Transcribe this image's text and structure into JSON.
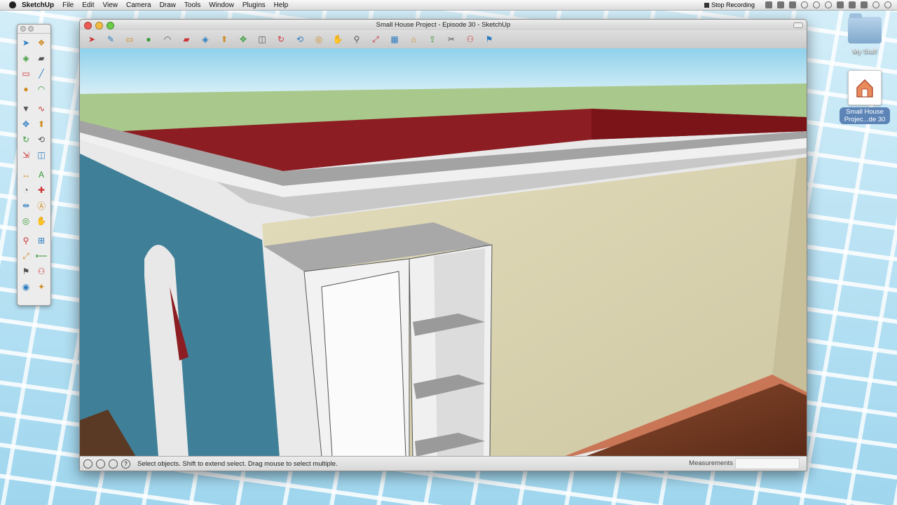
{
  "menubar": {
    "app_name": "SketchUp",
    "items": [
      "File",
      "Edit",
      "View",
      "Camera",
      "Draw",
      "Tools",
      "Window",
      "Plugins",
      "Help"
    ],
    "stop_recording": "Stop Recording"
  },
  "desktop": {
    "icon_folder_label": "My Stuff",
    "icon_file_label": "Small House Projec...de 30"
  },
  "window": {
    "title": "Small House Project - Episode 30 - SketchUp"
  },
  "statusbar": {
    "message": "Select objects. Shift to extend select. Drag mouse to select multiple.",
    "measurements_label": "Measurements",
    "measurements_value": ""
  },
  "colors": {
    "sky": "#8fd1ec",
    "ground": "#a9c98c",
    "wall_blue": "#3f8098",
    "wall_cream": "#d9d3b0",
    "roof_red": "#8c1d22",
    "floor_wood": "#6b3722"
  },
  "toolbar_icons": [
    "select-icon",
    "pencil-icon",
    "rectangle-icon",
    "circle-icon",
    "arc-icon",
    "eraser-icon",
    "paint-bucket-icon",
    "push-pull-icon",
    "move-icon",
    "offset-icon",
    "rotate-icon",
    "follow-me-icon",
    "orbit-icon",
    "pan-icon",
    "zoom-icon",
    "zoom-extents-icon",
    "components-icon",
    "warehouse-icon",
    "share-icon",
    "section-icon",
    "walk-icon",
    "position-camera-icon"
  ],
  "palette_icons": [
    "select-icon",
    "component-icon",
    "paint-bucket-icon",
    "eraser-icon",
    "rectangle-icon",
    "line-icon",
    "circle-icon",
    "arc-icon",
    "polygon-icon",
    "freehand-icon",
    "move-icon",
    "push-pull-icon",
    "rotate-icon",
    "follow-me-icon",
    "scale-icon",
    "offset-icon",
    "tape-measure-icon",
    "text-icon",
    "protractor-icon",
    "axes-icon",
    "dimension-icon",
    "3d-text-icon",
    "orbit-icon",
    "pan-icon",
    "zoom-icon",
    "zoom-window-icon",
    "zoom-extents-icon",
    "previous-view-icon",
    "position-camera-icon",
    "walk-icon",
    "look-around-icon",
    "section-plane-icon"
  ]
}
